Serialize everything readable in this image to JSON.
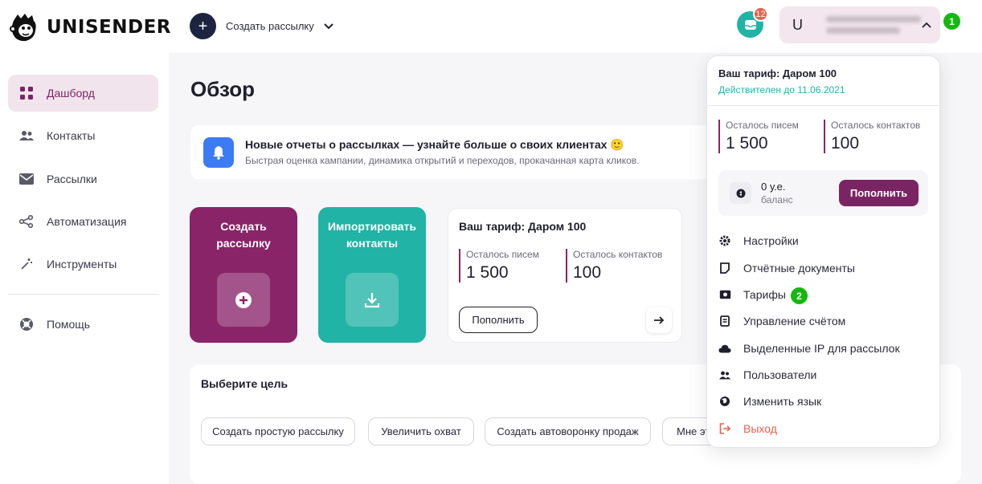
{
  "app": {
    "name": "UNISENDER"
  },
  "header": {
    "create_label": "Создать рассылку",
    "notifications_count": "12",
    "user_initial": "U"
  },
  "steps": {
    "one": "1",
    "two": "2"
  },
  "sidebar": {
    "items": [
      {
        "label": "Дашборд",
        "icon": "grid-icon",
        "active": true
      },
      {
        "label": "Контакты",
        "icon": "users-icon"
      },
      {
        "label": "Рассылки",
        "icon": "mail-icon"
      },
      {
        "label": "Автоматизация",
        "icon": "share-nodes-icon"
      },
      {
        "label": "Инструменты",
        "icon": "magic-wand-icon"
      },
      {
        "label": "Помощь",
        "icon": "lifebuoy-icon"
      }
    ]
  },
  "main": {
    "title": "Обзор",
    "banner": {
      "title": "Новые отчеты о рассылках — узнайте больше о своих клиентах 🙂",
      "subtitle": "Быстрая оценка кампании, динамика открытий и переходов, прокачанная карта кликов."
    },
    "tiles": {
      "create": "Создать рассылку",
      "import": "Импортировать контакты"
    },
    "tariff": {
      "title": "Ваш тариф: Даром 100",
      "letters_label": "Осталось писем",
      "letters_value": "1 500",
      "contacts_label": "Осталось контактов",
      "contacts_value": "100",
      "topup_label": "Пополнить"
    },
    "goals": {
      "title": "Выберите цель",
      "buttons": [
        "Создать простую рассылку",
        "Увеличить охват",
        "Создать автоворонку продаж",
        "Мне это"
      ]
    }
  },
  "dropdown": {
    "tariff_title": "Ваш тариф: Даром 100",
    "valid_until": "Действителен до 11.06.2021",
    "letters_label": "Осталось писем",
    "letters_value": "1 500",
    "contacts_label": "Осталось контактов",
    "contacts_value": "100",
    "balance_amount": "0 у.е.",
    "balance_label": "баланс",
    "topup_label": "Пополнить",
    "menu": [
      {
        "label": "Настройки",
        "icon": "gear-icon"
      },
      {
        "label": "Отчётные документы",
        "icon": "document-icon"
      },
      {
        "label": "Тарифы",
        "icon": "money-icon"
      },
      {
        "label": "Управление счётом",
        "icon": "invoice-icon"
      },
      {
        "label": "Выделенные IP для рассылок",
        "icon": "cloud-icon"
      },
      {
        "label": "Пользователи",
        "icon": "users-icon"
      },
      {
        "label": "Изменить язык",
        "icon": "globe-icon"
      },
      {
        "label": "Выход",
        "icon": "logout-icon"
      }
    ]
  },
  "colors": {
    "brand_purple": "#8a2469",
    "teal": "#21b3a6",
    "navy": "#1d2440",
    "step_green": "#15b80f",
    "logout_red": "#e8604b"
  }
}
